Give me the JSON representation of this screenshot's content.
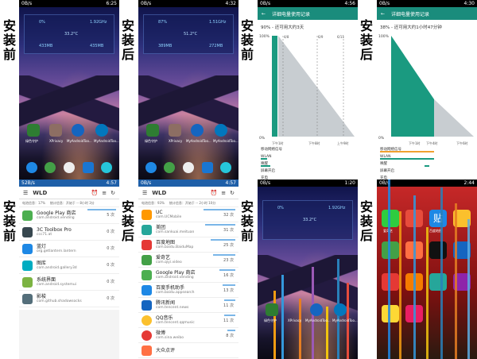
{
  "labels": {
    "before": "安装前",
    "after": "安装后"
  },
  "status": {
    "home_before_time": "6:25",
    "home_after_time": "4:32",
    "chart_before_time": "4:56",
    "chart_after_time": "4:30",
    "wld_before_time": "4:57",
    "wld_after_time": "4:57",
    "glitch_before_time": "1:20",
    "glitch_after_time": "2:44"
  },
  "widget": {
    "pct_before": "0%",
    "freq_before": "1.92GHz",
    "temp_before": "33.2°C",
    "mem_before": "433MB",
    "mem2_before": "435MB",
    "pct_after": "87%",
    "freq_after": "1.51GHz",
    "temp_after": "51.2°C",
    "mem_after": "389MB",
    "mem2_after": "272MB"
  },
  "homeapps": {
    "a1": "绿色守护",
    "a2": "XPrivacy",
    "a3": "MyAndroidToo...",
    "a4": "MyAndroidToo..."
  },
  "chart": {
    "title": "详细电量使用记录",
    "before_sub": "90% - 还可用大约3天",
    "after_sub": "38% - 还可用大约1小时47分钟",
    "ymax": "100%",
    "ymin": "0%",
    "before_dates": [
      "4/8",
      "6/9",
      "6/11"
    ],
    "before_x": [
      "下午1时",
      "下午8时",
      "上午9时"
    ],
    "after_x": [
      "下午1时",
      "下午4时",
      "下午6时"
    ],
    "rows": [
      "移动网络信号",
      "WLAN",
      "唤醒",
      "屏幕开启",
      "充电"
    ]
  },
  "chart_data": [
    {
      "type": "area",
      "title": "详细电量使用记录",
      "subtitle": "90% - 还可用大约3天",
      "ylim": [
        0,
        100
      ],
      "x": [
        "下午1时",
        "下午8时",
        "上午9时"
      ],
      "series": [
        {
          "values": [
            100,
            100,
            0
          ]
        }
      ]
    },
    {
      "type": "area",
      "title": "详细电量使用记录",
      "subtitle": "38% - 还可用大约1小时47分钟",
      "ylim": [
        0,
        100
      ],
      "x": [
        "下午1时",
        "下午4时",
        "下午6时"
      ],
      "series": [
        {
          "values": [
            100,
            38,
            0
          ]
        }
      ]
    }
  ],
  "wld": {
    "title": "WLD",
    "before_info_l": "电池信息：17%",
    "before_info_m": "统计信息：开始于 -- 8小时 3分",
    "before_info_r": "",
    "after_info_l": "电池信息：93%",
    "after_info_m": "统计信息：开始于 -- 2小时 10分",
    "before": [
      {
        "name": "Google Play 商店",
        "pkg": "com.android.vending",
        "count": "5 次"
      },
      {
        "name": "3C Toolbox Pro",
        "pkg": "ccc71.at",
        "count": "0 次"
      },
      {
        "name": "蓝灯",
        "pkg": "org.getlantern.lantern",
        "count": "0 次"
      },
      {
        "name": "图库",
        "pkg": "com.android.gallery3d",
        "count": "0 次"
      },
      {
        "name": "系统界面",
        "pkg": "com.android.systemui",
        "count": "0 次"
      },
      {
        "name": "影梭",
        "pkg": "com.github.shadowsocks",
        "count": "0 次"
      }
    ],
    "after": [
      {
        "name": "UC",
        "pkg": "com.UCMobile",
        "count": "32 次"
      },
      {
        "name": "美团",
        "pkg": "com.sankuai.meituan",
        "count": "31 次"
      },
      {
        "name": "百度地图",
        "pkg": "com.baidu.BaiduMap",
        "count": "25 次"
      },
      {
        "name": "爱奇艺",
        "pkg": "com.qiyi.video",
        "count": "23 次"
      },
      {
        "name": "Google Play 商店",
        "pkg": "com.android.vending",
        "count": "16 次"
      },
      {
        "name": "百度手机助手",
        "pkg": "com.baidu.appsearch",
        "count": "13 次"
      },
      {
        "name": "腾讯新闻",
        "pkg": "com.tencent.news",
        "count": "11 次"
      },
      {
        "name": "QQ音乐",
        "pkg": "com.tencent.qqmusic",
        "count": "11 次"
      },
      {
        "name": "微博",
        "pkg": "com.sina.weibo",
        "count": "8 次"
      },
      {
        "name": "大众点评",
        "pkg": "",
        "count": ""
      }
    ]
  },
  "glitch": {
    "a1": "爱奇艺",
    "a2": "贴",
    "a3": "百度地图"
  }
}
